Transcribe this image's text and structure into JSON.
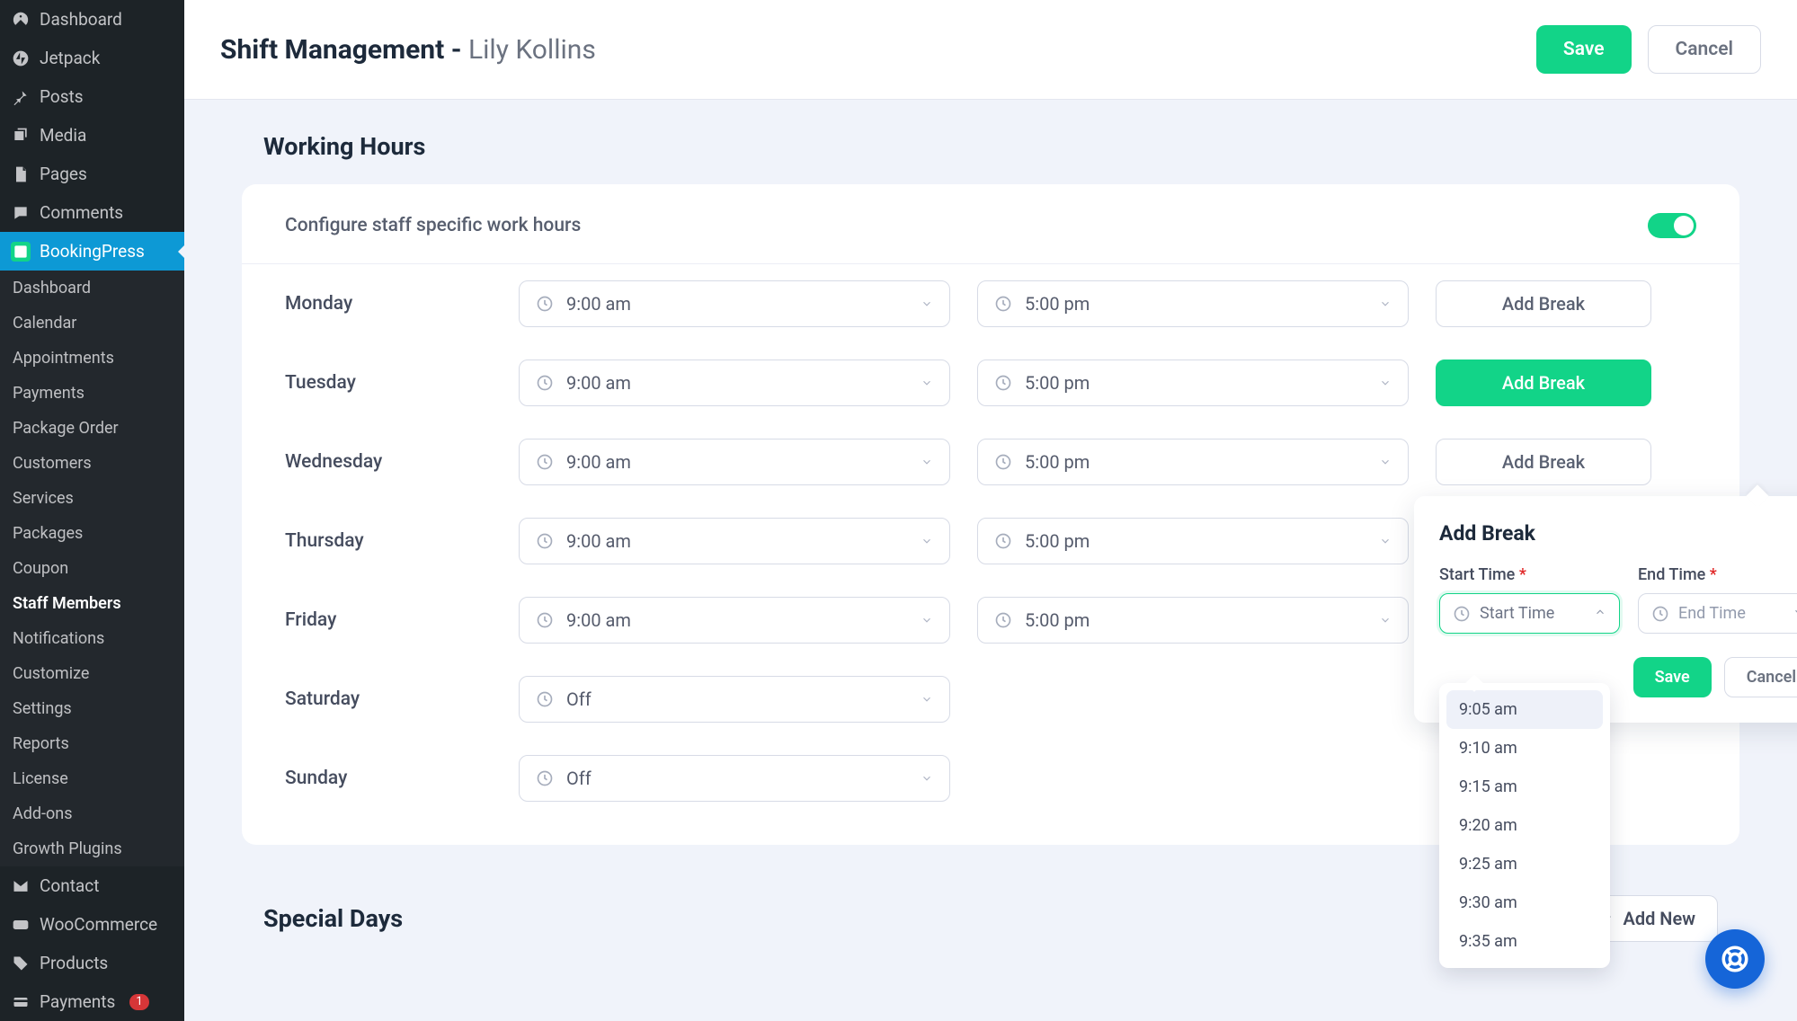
{
  "sidebar": {
    "items": [
      {
        "label": "Dashboard",
        "icon": "gauge"
      },
      {
        "label": "Jetpack",
        "icon": "jetpack"
      },
      {
        "label": "Posts",
        "icon": "pin"
      },
      {
        "label": "Media",
        "icon": "media"
      },
      {
        "label": "Pages",
        "icon": "pages"
      },
      {
        "label": "Comments",
        "icon": "comment"
      },
      {
        "label": "BookingPress",
        "icon": "bp",
        "active": true
      }
    ],
    "submenu": [
      {
        "label": "Dashboard"
      },
      {
        "label": "Calendar"
      },
      {
        "label": "Appointments"
      },
      {
        "label": "Payments"
      },
      {
        "label": "Package Order"
      },
      {
        "label": "Customers"
      },
      {
        "label": "Services"
      },
      {
        "label": "Packages"
      },
      {
        "label": "Coupon"
      },
      {
        "label": "Staff Members",
        "active": true
      },
      {
        "label": "Notifications"
      },
      {
        "label": "Customize"
      },
      {
        "label": "Settings"
      },
      {
        "label": "Reports"
      },
      {
        "label": "License"
      },
      {
        "label": "Add-ons"
      },
      {
        "label": "Growth Plugins"
      }
    ],
    "items_after": [
      {
        "label": "Contact",
        "icon": "mail"
      },
      {
        "label": "WooCommerce",
        "icon": "woo"
      },
      {
        "label": "Products",
        "icon": "products"
      },
      {
        "label": "Payments",
        "icon": "payments",
        "badge": "1"
      }
    ]
  },
  "header": {
    "title_prefix": "Shift Management - ",
    "title_name": "Lily Kollins",
    "save": "Save",
    "cancel": "Cancel"
  },
  "working_hours": {
    "title": "Working Hours",
    "subtitle": "Configure staff specific work hours",
    "toggle_on": true,
    "add_break": "Add Break",
    "days": [
      {
        "name": "Monday",
        "start": "9:00 am",
        "end": "5:00 pm"
      },
      {
        "name": "Tuesday",
        "start": "9:00 am",
        "end": "5:00 pm",
        "break_green": true
      },
      {
        "name": "Wednesday",
        "start": "9:00 am",
        "end": "5:00 pm"
      },
      {
        "name": "Thursday",
        "start": "9:00 am",
        "end": "5:00 pm"
      },
      {
        "name": "Friday",
        "start": "9:00 am",
        "end": "5:00 pm"
      },
      {
        "name": "Saturday",
        "start": "Off",
        "off": true
      },
      {
        "name": "Sunday",
        "start": "Off",
        "off": true
      }
    ]
  },
  "break_popover": {
    "title": "Add Break",
    "start_label": "Start Time",
    "end_label": "End Time",
    "start_placeholder": "Start Time",
    "end_placeholder": "End Time",
    "save": "Save",
    "cancel": "Cancel"
  },
  "time_dropdown": {
    "options": [
      "9:05 am",
      "9:10 am",
      "9:15 am",
      "9:20 am",
      "9:25 am",
      "9:30 am",
      "9:35 am"
    ],
    "highlighted": "9:05 am"
  },
  "special_days": {
    "title": "Special Days",
    "add_new": "Add New"
  }
}
